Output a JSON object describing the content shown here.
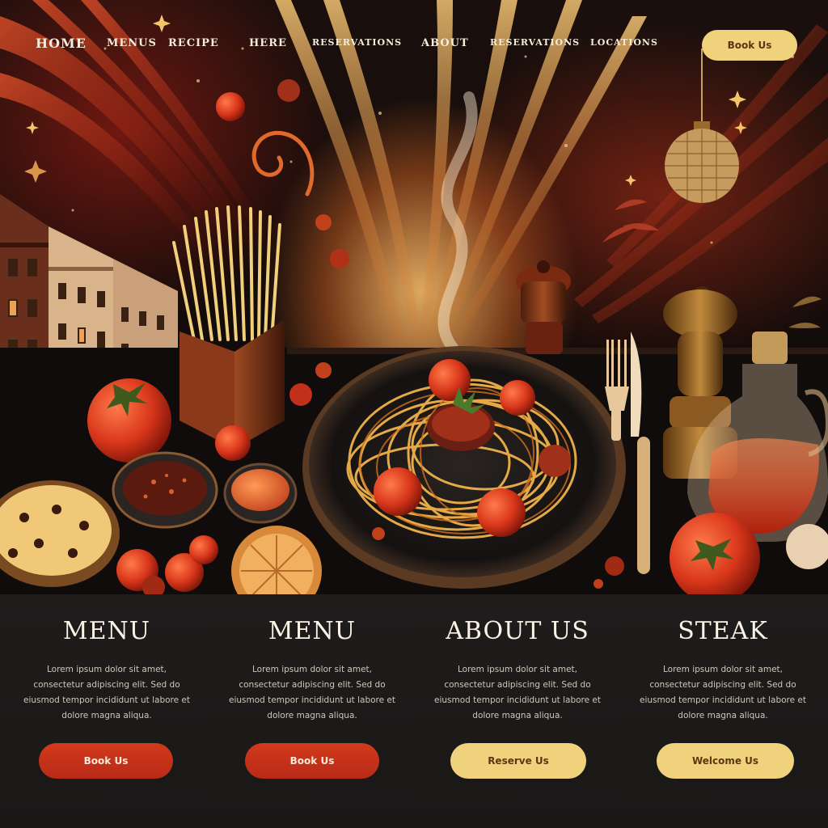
{
  "nav": {
    "items": [
      {
        "label": "HOME"
      },
      {
        "label": "MENUS"
      },
      {
        "label": "RECIPE"
      },
      {
        "label": "HERE"
      },
      {
        "label": "RESERVATIONS"
      },
      {
        "label": "ABOUT"
      },
      {
        "label": "RESERVATIONS"
      },
      {
        "label": "LOCATIONS"
      }
    ],
    "book_label": "Book Us"
  },
  "cards": [
    {
      "title": "MENU",
      "text": "Lorem ipsum dolor sit amet, consectetur adipiscing elit. Sed do eiusmod tempor incididunt ut labore et dolore magna aliqua.",
      "button": "Book Us",
      "style": "red"
    },
    {
      "title": "MENU",
      "text": "Lorem ipsum dolor sit amet, consectetur adipiscing elit. Sed do eiusmod tempor incididunt ut labore et dolore magna aliqua.",
      "button": "Book Us",
      "style": "red"
    },
    {
      "title": "ABOUT US",
      "text": "Lorem ipsum dolor sit amet, consectetur adipiscing elit. Sed do eiusmod tempor incididunt ut labore et dolore magna aliqua.",
      "button": "Reserve Us",
      "style": "gold"
    },
    {
      "title": "STEAK",
      "text": "Lorem ipsum dolor sit amet, consectetur adipiscing elit. Sed do eiusmod tempor incididunt ut labore et dolore magna aliqua.",
      "button": "Welcome Us",
      "style": "gold"
    }
  ],
  "colors": {
    "accent_red": "#c8321a",
    "accent_gold": "#f1d27c",
    "background": "#151312"
  }
}
